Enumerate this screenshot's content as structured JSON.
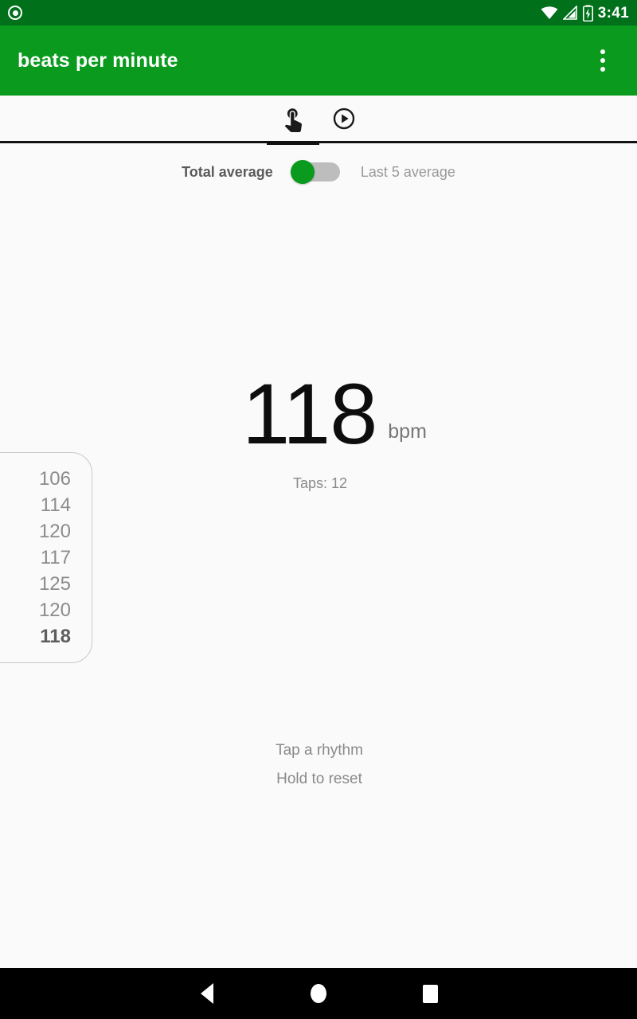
{
  "status_bar": {
    "notification_icon": "notification-circle-icon",
    "wifi_icon": "wifi-icon",
    "signal_icon": "signal-cellular-icon",
    "battery_icon": "battery-charging-icon",
    "time": "3:41",
    "background_color": "#00701a"
  },
  "app_bar": {
    "title": "beats per minute",
    "overflow_icon": "more-vert-icon",
    "background_color": "#0a9a1e",
    "text_color": "#ffffff"
  },
  "tabs": [
    {
      "id": "tap",
      "icon": "touch-app-icon",
      "active": true
    },
    {
      "id": "play",
      "icon": "play-circle-outline-icon",
      "active": false
    }
  ],
  "average_toggle": {
    "left_label": "Total average",
    "right_label": "Last 5 average",
    "selected": "Total average",
    "knob_color": "#0a9a1e",
    "track_color": "#bdbdbd"
  },
  "reading": {
    "bpm_value": "118",
    "unit": "bpm",
    "taps_text": "Taps: 12"
  },
  "history": {
    "items": [
      {
        "value": "106",
        "current": false
      },
      {
        "value": "114",
        "current": false
      },
      {
        "value": "120",
        "current": false
      },
      {
        "value": "117",
        "current": false
      },
      {
        "value": "125",
        "current": false
      },
      {
        "value": "120",
        "current": false
      },
      {
        "value": "118",
        "current": true
      }
    ]
  },
  "hints": {
    "line1": "Tap a rhythm",
    "line2": "Hold to reset"
  },
  "nav_bar": {
    "back_icon": "back-triangle-icon",
    "home_icon": "home-circle-icon",
    "recents_icon": "recents-square-icon",
    "background_color": "#000000"
  }
}
